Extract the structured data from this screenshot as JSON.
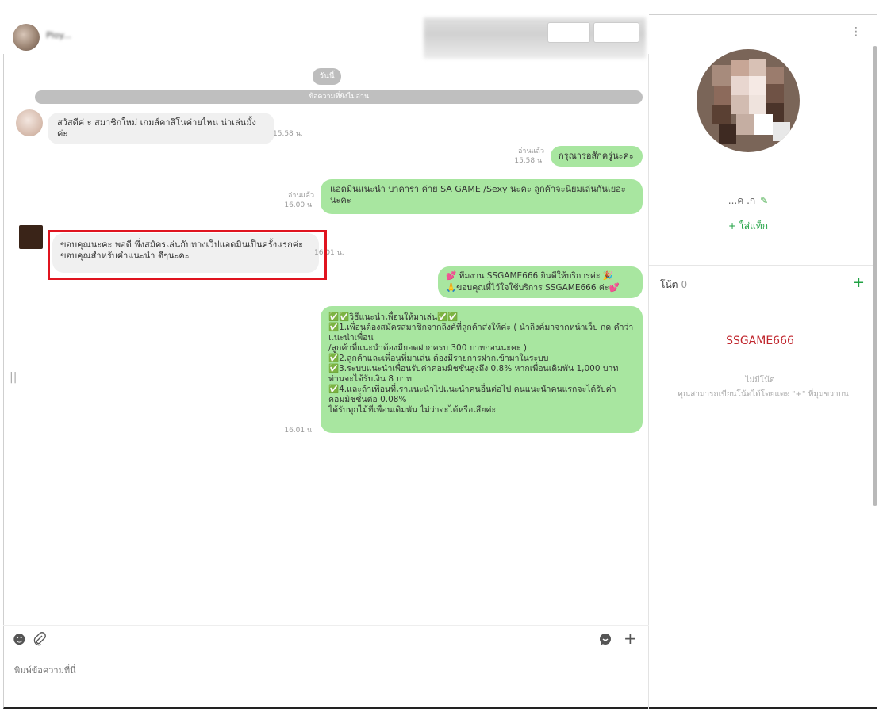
{
  "header": {
    "contact_name": "Ploy..."
  },
  "chat": {
    "day_label": "วันนี้",
    "unread_label": "ข้อความที่ยังไม่อ่าน",
    "messages": [
      {
        "side": "in",
        "text": "สวัสดีค่ ะ สมาชิกใหม่ เกมส์คาสิโนค่ายไหน น่าเล่นมั้งค่ะ",
        "time": "15.58 น."
      },
      {
        "side": "out",
        "read": "อ่านแล้ว",
        "time": "15.58 น.",
        "text": "กรุณารอสักครู่นะคะ"
      },
      {
        "side": "out",
        "read": "อ่านแล้ว",
        "time": "16.00 น.",
        "text": "แอดมินแนะนำ บาคาร่า ค่าย SA GAME /Sexy นะคะ ลูกค้าจะนิยมเล่นกันเยอะ นะคะ"
      },
      {
        "side": "in",
        "text": "ขอบคุณนะคะ พอดี พึ่งสมัครเล่นกับทางเว็ปแอดมินเป็นครั้งแรกค่ะ\nขอบคุณสำหรับคำแนะนำ ดีๆนะคะ",
        "time": "16.01 น."
      },
      {
        "side": "out",
        "time": "",
        "text": "💕 ทีมงาน SSGAME666 ยินดีให้บริการค่ะ 🎉\n🙏ขอบคุณที่ไว้ใจใช้บริการ SSGAME666 ค่ะ💕"
      },
      {
        "side": "out",
        "time": "16.01 น.",
        "text": "✅✅วิธีแนะนำเพื่อนให้มาเล่น✅✅\n✅1.เพื่อนต้องสมัครสมาชิกจากลิงค์ที่ลูกค้าส่งให้ค่ะ ( นำลิงค์มาจากหน้าเว็บ กด คำว่าแนะนำเพื่อน\n/ลูกค้าที่แนะนำต้องมียอดฝากครบ 300 บาทก่อนนะคะ )\n✅2.ลูกค้าและเพื่อนที่มาเล่น ต้องมีรายการฝากเข้ามาในระบบ\n✅3.ระบบแนะนำเพื่อนรับค่าคอมมิชชั่นสูงถึง 0.8% หากเพื่อนเดิมพัน 1,000 บาท ท่านจะได้รับเงิน 8 บาท\n✅4.และถ้าเพื่อนที่เราแนะนำไปแนะนำคนอื่นต่อไป คนแนะนำคนแรกจะได้รับค่า คอมมิชชั่นต่อ 0.08%\nได้รับทุกไม้ที่เพื่อนเดิมพัน ไม่ว่าจะได้หรือเสียค่ะ"
      }
    ]
  },
  "input": {
    "placeholder": "พิมพ์ข้อความที่นี่",
    "emoji_icon": "smiley-icon",
    "attach_icon": "paperclip-icon",
    "sticker_icon": "chat-bubble-icon",
    "plus_icon": "plus-icon"
  },
  "profile": {
    "name": "...ค .ก",
    "add_tag": "+ ใส่แท็ก"
  },
  "notes": {
    "title": "โน้ต",
    "count": "0",
    "add": "+",
    "brand": "SSGAME666",
    "empty_title": "ไม่มีโน้ต",
    "empty_hint": "คุณสามารถเขียนโน้ตได้โดยแตะ \"+\" ที่มุมขวาบน"
  },
  "colors": {
    "bubble_out": "#a8e6a0",
    "bubble_in": "#f0f0f0",
    "accent_green": "#21a244",
    "highlight_red": "#e0141f",
    "brand_red": "#c0262d"
  }
}
